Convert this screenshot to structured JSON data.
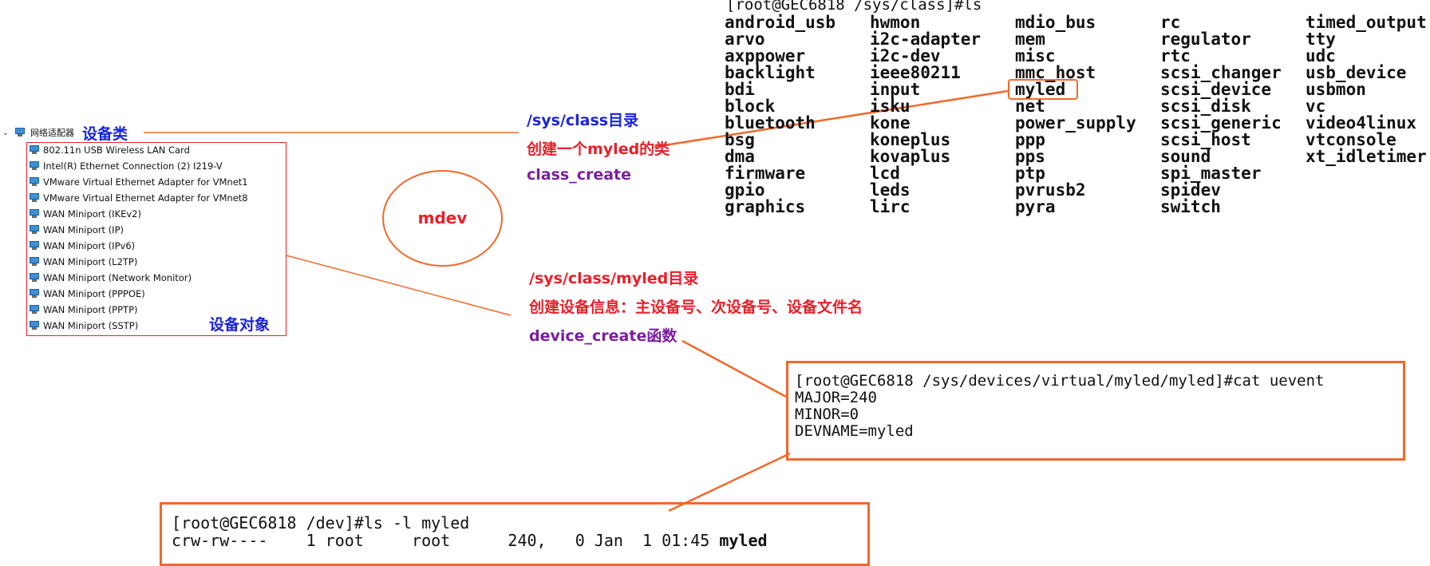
{
  "tree": {
    "chevron": "⌄",
    "category": "网络适配器",
    "category_label": "设备类",
    "items": [
      "802.11n USB Wireless LAN Card",
      "Intel(R) Ethernet Connection (2) I219-V",
      "VMware Virtual Ethernet Adapter for VMnet1",
      "VMware Virtual Ethernet Adapter for VMnet8",
      "WAN Miniport (IKEv2)",
      "WAN Miniport (IP)",
      "WAN Miniport (IPv6)",
      "WAN Miniport (L2TP)",
      "WAN Miniport (Network Monitor)",
      "WAN Miniport (PPPOE)",
      "WAN Miniport (PPTP)",
      "WAN Miniport (SSTP)"
    ],
    "object_label": "设备对象"
  },
  "mdev": "mdev",
  "class_note": {
    "dir": "/sys/class目录",
    "create": "创建一个myled的类",
    "func": "class_create"
  },
  "device_note": {
    "dir": "/sys/class/myled目录",
    "create": "创建设备信息：主设备号、次设备号、设备文件名",
    "func": "device_create函数"
  },
  "ls_class": {
    "prompt": "[root@GEC6818 /sys/class]#ls",
    "columns": [
      [
        "android_usb",
        "arvo",
        "axppower",
        "backlight",
        "bdi",
        "block",
        "bluetooth",
        "bsg",
        "dma",
        "firmware",
        "gpio",
        "graphics"
      ],
      [
        "hwmon",
        "i2c-adapter",
        "i2c-dev",
        "ieee80211",
        "input",
        "isku",
        "kone",
        "koneplus",
        "kovaplus",
        "lcd",
        "leds",
        "lirc"
      ],
      [
        "mdio_bus",
        "mem",
        "misc",
        "mmc_host",
        "myled",
        "net",
        "power_supply",
        "ppp",
        "pps",
        "ptp",
        "pvrusb2",
        "pyra"
      ],
      [
        "rc",
        "regulator",
        "rtc",
        "scsi_changer",
        "scsi_device",
        "scsi_disk",
        "scsi_generic",
        "scsi_host",
        "sound",
        "spi_master",
        "spidev",
        "switch"
      ],
      [
        "timed_output",
        "tty",
        "udc",
        "usb_device",
        "usbmon",
        "vc",
        "video4linux",
        "vtconsole",
        "xt_idletimer"
      ]
    ]
  },
  "uevent": {
    "prompt": "[root@GEC6818 /sys/devices/virtual/myled/myled]#cat uevent",
    "major": "MAJOR=240",
    "minor": "MINOR=0",
    "devname": "DEVNAME=myled"
  },
  "ls_dev": {
    "prompt": "[root@GEC6818 /dev]#ls -l myled",
    "line": "crw-rw----    1 root     root      240,   0 Jan  1 01:45 ",
    "name": "myled"
  },
  "colors": {
    "accent_orange": "#f0692a",
    "red": "#e8202a",
    "blue": "#1a25d8",
    "purple": "#7a1f9e"
  }
}
